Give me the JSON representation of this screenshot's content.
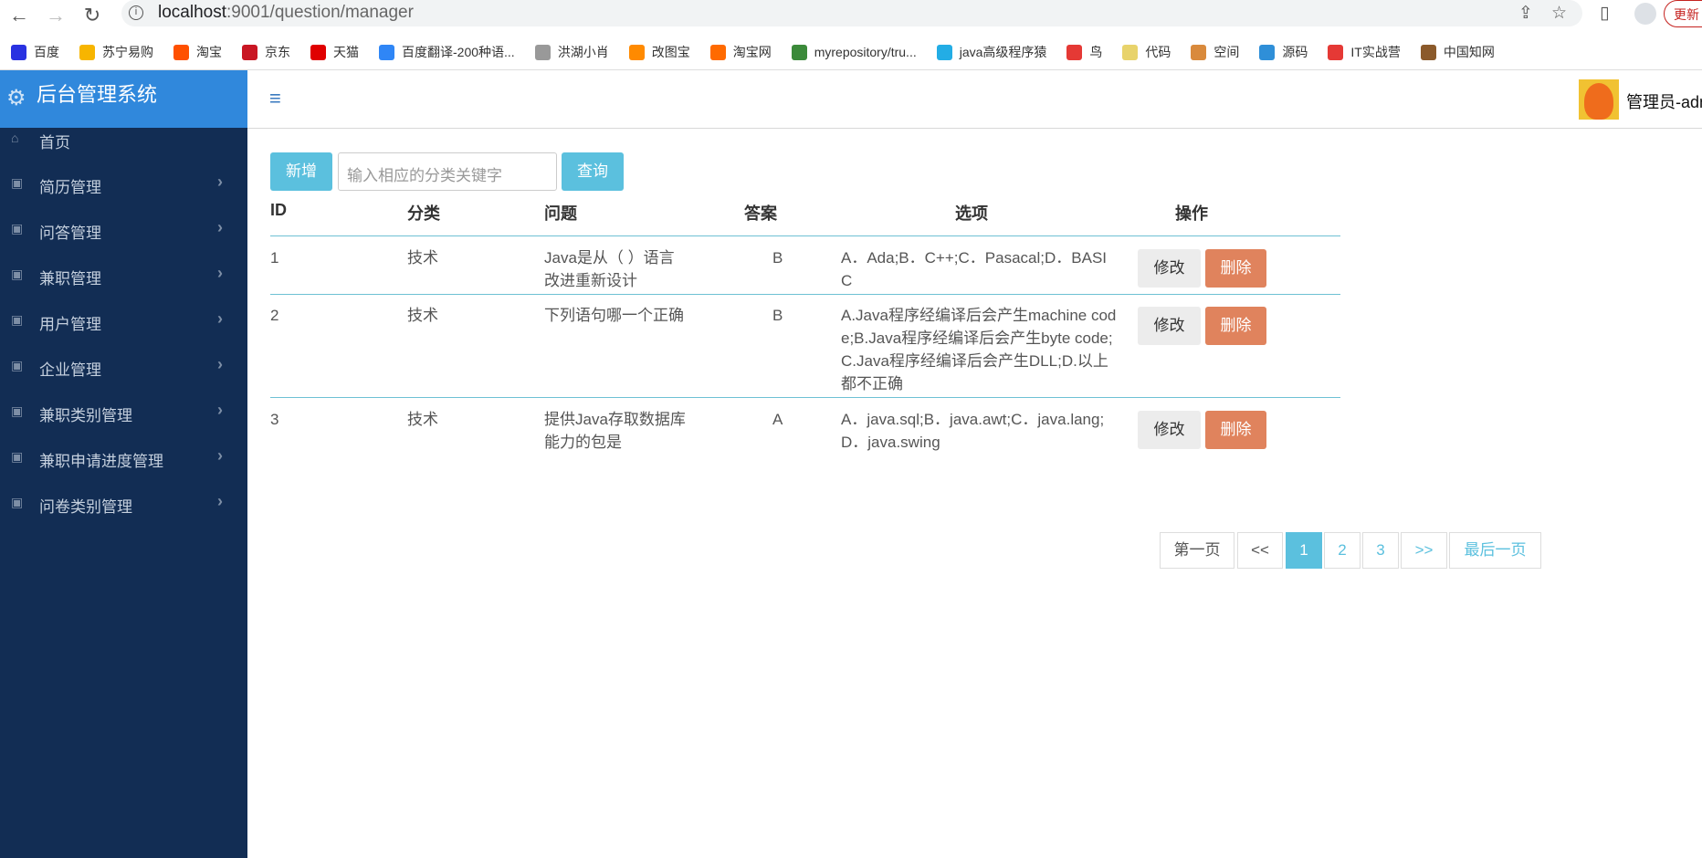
{
  "browser": {
    "url_host": "localhost",
    "url_path": ":9001/question/manager",
    "update_label": "更新",
    "bookmarks": [
      {
        "label": "百度",
        "color": "#2932e1"
      },
      {
        "label": "苏宁易购",
        "color": "#f7b500"
      },
      {
        "label": "淘宝",
        "color": "#ff5000"
      },
      {
        "label": "京东",
        "color": "#c91623"
      },
      {
        "label": "天猫",
        "color": "#e00000"
      },
      {
        "label": "百度翻译-200种语...",
        "color": "#2f86f6"
      },
      {
        "label": "洪湖小肖",
        "color": "#999999"
      },
      {
        "label": "改图宝",
        "color": "#ff8a00"
      },
      {
        "label": "淘宝网",
        "color": "#ff6a00"
      },
      {
        "label": "myrepository/tru...",
        "color": "#3b8a3a"
      },
      {
        "label": "java高级程序猿",
        "color": "#23ade5"
      },
      {
        "label": "鸟",
        "color": "#e53935"
      },
      {
        "label": "代码",
        "color": "#e8d36b"
      },
      {
        "label": "空间",
        "color": "#d98a3c"
      },
      {
        "label": "源码",
        "color": "#2f8fd8"
      },
      {
        "label": "IT实战营",
        "color": "#e53935"
      },
      {
        "label": "中国知网",
        "color": "#8b5a2b"
      }
    ]
  },
  "sidebar": {
    "title": "后台管理系统",
    "items": [
      {
        "label": "首页",
        "icon": "home-icon"
      },
      {
        "label": "简历管理",
        "icon": "gift-icon"
      },
      {
        "label": "问答管理",
        "icon": "gift-icon"
      },
      {
        "label": "兼职管理",
        "icon": "gift-icon"
      },
      {
        "label": "用户管理",
        "icon": "gift-icon"
      },
      {
        "label": "企业管理",
        "icon": "gift-icon"
      },
      {
        "label": "兼职类别管理",
        "icon": "gift-icon"
      },
      {
        "label": "兼职申请进度管理",
        "icon": "gift-icon"
      },
      {
        "label": "问卷类别管理",
        "icon": "gift-icon"
      }
    ]
  },
  "header": {
    "user": "管理员-adm"
  },
  "toolbar": {
    "add_label": "新增",
    "search_placeholder": "输入相应的分类关键字",
    "query_label": "查询"
  },
  "table": {
    "columns": [
      "ID",
      "分类",
      "问题",
      "答案",
      "选项",
      "操作"
    ],
    "rows": [
      {
        "id": "1",
        "category": "技术",
        "question": "Java是从（ ）语言改进重新设计",
        "answer": "B",
        "options": "A．Ada;B．C++;C．Pasacal;D．BASIC"
      },
      {
        "id": "2",
        "category": "技术",
        "question": "下列语句哪一个正确",
        "answer": "B",
        "options": "A.Java程序经编译后会产生machine code;B.Java程序经编译后会产生byte code;C.Java程序经编译后会产生DLL;D.以上都不正确"
      },
      {
        "id": "3",
        "category": "技术",
        "question": "提供Java存取数据库能力的包是",
        "answer": "A",
        "options": "A．java.sql;B．java.awt;C．java.lang;D．java.swing"
      }
    ],
    "edit_label": "修改",
    "delete_label": "删除"
  },
  "pagination": {
    "first": "第一页",
    "prev": "<<",
    "pages": [
      "1",
      "2",
      "3"
    ],
    "current": "1",
    "next": ">>",
    "last": "最后一页"
  },
  "colors": {
    "accent": "#5bc0de",
    "sidebar": "#122d54",
    "brand": "#3088dc",
    "danger": "#e0835d"
  }
}
